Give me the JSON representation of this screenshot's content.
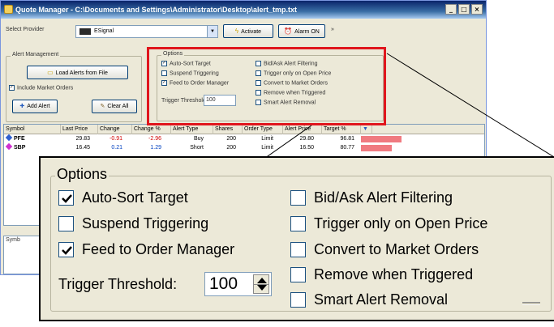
{
  "window": {
    "title": "Quote Manager - C:\\Documents and Settings\\Administrator\\Desktop\\alert_tmp.txt",
    "min_label": "_",
    "max_label": "□",
    "close_label": "×"
  },
  "provider": {
    "label": "Select Provider",
    "value": "ESignal",
    "activate_label": "Activate",
    "alarm_label": "Alarm ON",
    "extra_label": "»"
  },
  "alert_management": {
    "legend": "Alert Management",
    "load_label": "Load Alerts from File",
    "include_label": "Include Market Orders",
    "add_label": "Add Alert",
    "clear_label": "Clear All"
  },
  "options": {
    "legend": "Options",
    "left": [
      {
        "label": "Auto-Sort Target",
        "checked": true
      },
      {
        "label": "Suspend Triggering",
        "checked": false
      },
      {
        "label": "Feed to Order Manager",
        "checked": true
      }
    ],
    "right": [
      {
        "label": "Bid/Ask Alert Filtering",
        "checked": false
      },
      {
        "label": "Trigger only on Open Price",
        "checked": false
      },
      {
        "label": "Convert to Market Orders",
        "checked": false
      },
      {
        "label": "Remove when Triggered",
        "checked": false
      },
      {
        "label": "Smart Alert Removal",
        "checked": false
      }
    ],
    "threshold_label": "Trigger Threshold:",
    "threshold_value": "100"
  },
  "grid": {
    "columns": [
      "Symbol",
      "Last Price",
      "Change",
      "Change %",
      "Alert Type",
      "Shares",
      "Order Type",
      "Alert Price",
      "Target %"
    ],
    "rows": [
      {
        "symbol": "PFE",
        "last": "29.83",
        "change": "-0.91",
        "change_pct": "-2.96",
        "type": "Buy",
        "shares": "200",
        "order": "Limit",
        "alert": "29.80",
        "target": "96.81",
        "target_fill": 0.9
      },
      {
        "symbol": "SBP",
        "last": "16.45",
        "change": "0.21",
        "change_pct": "1.29",
        "type": "Short",
        "shares": "200",
        "order": "Limit",
        "alert": "16.50",
        "target": "80.77",
        "target_fill": 0.65
      }
    ],
    "second_header": "Symb",
    "colors": {
      "buy": "#3060d0",
      "short": "#d030d0"
    }
  }
}
